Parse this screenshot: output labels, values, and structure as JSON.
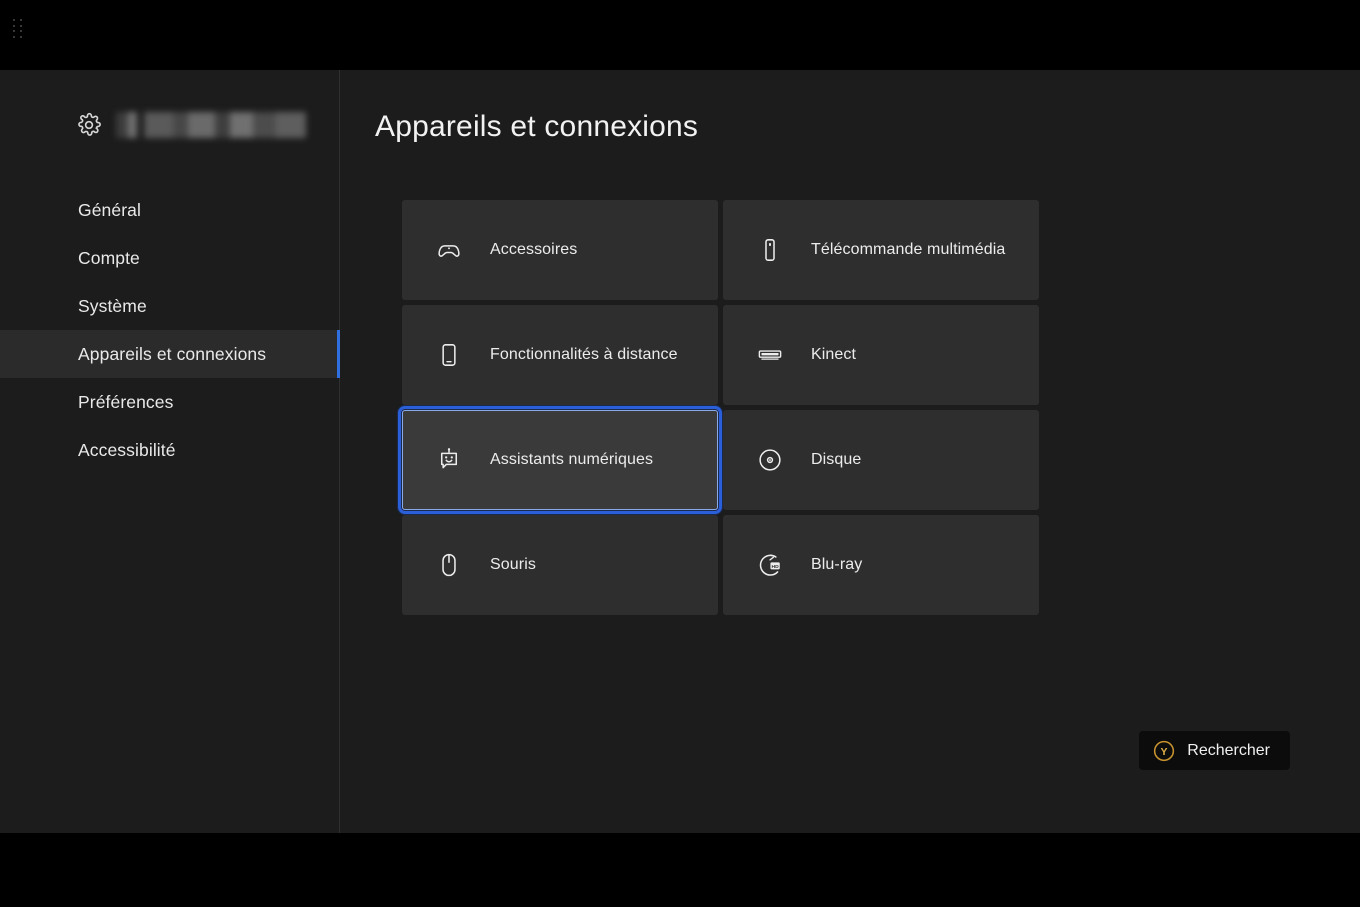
{
  "window": {
    "drag_handle_icon": "drag-dots-icon"
  },
  "sidebar": {
    "account": {
      "gear_icon": "gear-icon",
      "name_redacted": ""
    },
    "items": [
      {
        "label": "Général",
        "selected": false
      },
      {
        "label": "Compte",
        "selected": false
      },
      {
        "label": "Système",
        "selected": false
      },
      {
        "label": "Appareils et connexions",
        "selected": true
      },
      {
        "label": "Préférences",
        "selected": false
      },
      {
        "label": "Accessibilité",
        "selected": false
      }
    ]
  },
  "content": {
    "title": "Appareils et connexions",
    "tiles": [
      {
        "label": "Accessoires",
        "icon": "controller-icon",
        "focused": false
      },
      {
        "label": "Télécommande multimédia",
        "icon": "remote-icon",
        "focused": false
      },
      {
        "label": "Fonctionnalités à distance",
        "icon": "phone-icon",
        "focused": false
      },
      {
        "label": "Kinect",
        "icon": "kinect-icon",
        "focused": false
      },
      {
        "label": "Assistants numériques",
        "icon": "robot-icon",
        "focused": true
      },
      {
        "label": "Disque",
        "icon": "disc-icon",
        "focused": false
      },
      {
        "label": "Souris",
        "icon": "mouse-icon",
        "focused": false
      },
      {
        "label": "Blu-ray",
        "icon": "bluray-icon",
        "focused": false
      }
    ]
  },
  "footer": {
    "search_button": {
      "label": "Rechercher",
      "button_glyph": "Y",
      "icon": "y-button-icon"
    }
  },
  "colors": {
    "page_bg": "#1c1c1c",
    "letterbox": "#000000",
    "tile_bg": "#2e2e2e",
    "tile_focus_bg": "#3a3a3a",
    "focus_border": "#2b5fd9",
    "nav_selected_bg": "#2b2b2b",
    "nav_accent": "#2f6fe0",
    "text_primary": "#ececec",
    "y_button_gold": "#d9a441"
  }
}
